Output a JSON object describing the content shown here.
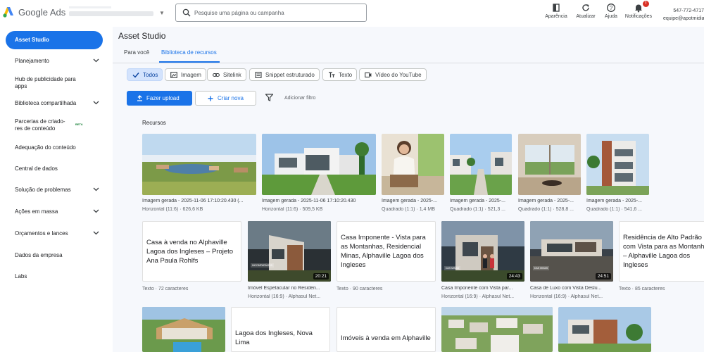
{
  "header": {
    "brand": "Google Ads",
    "search_placeholder": "Pesquise uma página ou campanha",
    "tools": [
      {
        "label": "Aparência",
        "icon": "appearance-icon"
      },
      {
        "label": "Atualizar",
        "icon": "refresh-icon"
      },
      {
        "label": "Ajuda",
        "icon": "help-icon"
      },
      {
        "label": "Notificações",
        "icon": "bell-icon",
        "badge": "!"
      }
    ],
    "user_id": "547-772-4717",
    "user_email": "equipe@apotmidias"
  },
  "sidebar": {
    "items": [
      {
        "label": "Asset Studio",
        "active": true
      },
      {
        "label": "Planejamento",
        "expandable": true
      },
      {
        "label": "Hub de publicidade para apps"
      },
      {
        "label": "Biblioteca compartilhada",
        "expandable": true
      },
      {
        "label": "Parcerias de criado-res de conteúdo",
        "badge": "BETA"
      },
      {
        "label": "Adequação do conteúdo"
      },
      {
        "label": "Central de dados"
      },
      {
        "label": "Solução de problemas",
        "expandable": true
      },
      {
        "label": "Ações em massa",
        "expandable": true
      },
      {
        "label": "Orçamentos e lances",
        "expandable": true
      },
      {
        "label": "Dados da empresa"
      },
      {
        "label": "Labs"
      }
    ]
  },
  "main": {
    "title": "Asset Studio",
    "tabs": [
      {
        "label": "Para você",
        "active": false
      },
      {
        "label": "Biblioteca de recursos",
        "active": true
      }
    ],
    "chips": [
      {
        "label": "Todos",
        "icon": "check-icon",
        "active": true
      },
      {
        "label": "Imagem",
        "icon": "image-icon"
      },
      {
        "label": "Sitelink",
        "icon": "link-icon"
      },
      {
        "label": "Snippet estruturado",
        "icon": "snippet-icon"
      },
      {
        "label": "Texto",
        "icon": "text-icon"
      },
      {
        "label": "Vídeo do YouTube",
        "icon": "video-icon"
      }
    ],
    "upload_label": "Fazer upload",
    "create_label": "Criar nova",
    "filter_label": "Adicionar filtro",
    "section_title": "Recursos",
    "row1": [
      {
        "title": "Imagem gerada - 2025-11-06 17:10:20.430 (...",
        "meta": "Horizontal (11:6) · 626,6 KB"
      },
      {
        "title": "Imagem gerada - 2025-11-06 17:10:20.430",
        "meta": "Horizontal (11:6) · 509,5 KB"
      },
      {
        "title": "Imagem gerada - 2025-...",
        "meta": "Quadrado (1:1) · 1,4 MB"
      },
      {
        "title": "Imagem gerada - 2025-...",
        "meta": "Quadrado (1:1) · 521,3 ..."
      },
      {
        "title": "Imagem gerada - 2025-...",
        "meta": "Quadrado (1:1) · 528,8 ..."
      },
      {
        "title": "Imagem gerada - 2025-...",
        "meta": "Quadrado (1:1) · 541,6 ..."
      }
    ],
    "row2": [
      {
        "type": "text",
        "text": "Casa à venda no Alphaville Lagoa dos Ingleses – Projeto Ana Paula Rohlfs",
        "meta": "Texto · 72 caracteres"
      },
      {
        "type": "video",
        "duration": "20:21",
        "title": "Imóvel Espetacular no Residen...",
        "meta": "Horizontal (16:9) · Alphasul Net...",
        "tag": "INCOMPARÁVEIS"
      },
      {
        "type": "text",
        "text": "Casa Imponente - Vista para as Montanhas, Residencial Minas, Alphaville Lagoa dos Ingleses",
        "meta": "Texto · 90 caracteres"
      },
      {
        "type": "video",
        "duration": "24:43",
        "title": "Casa Imponente com Vista par...",
        "meta": "Horizontal (16:9) · Alphasul Net...",
        "tag": "DAS MINAS"
      },
      {
        "type": "video",
        "duration": "24:51",
        "title": "Casa de Luxo com Vista Deslu...",
        "meta": "Horizontal (16:9) · Alphasul Net...",
        "tag": "DAS MINAS"
      },
      {
        "type": "text",
        "text": "Residência de Alto Padrão com Vista para as Montanhas – Alphaville Lagoa dos Ingleses",
        "meta": "Texto · 85 caracteres"
      }
    ],
    "row3": [
      {
        "type": "image"
      },
      {
        "type": "text",
        "text": "Lagoa dos Ingleses, Nova Lima"
      },
      {
        "type": "text",
        "text": "Imóveis à venda em Alphaville"
      },
      {
        "type": "image"
      },
      {
        "type": "image"
      }
    ]
  }
}
